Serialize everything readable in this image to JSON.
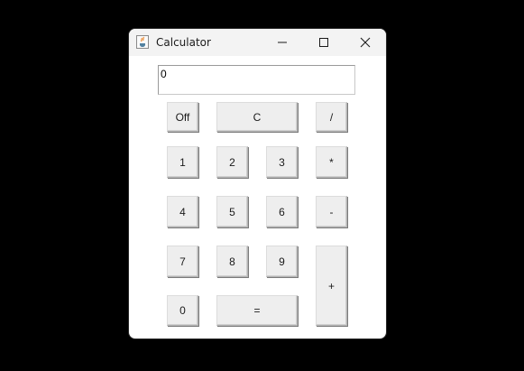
{
  "window": {
    "title": "Calculator",
    "app_icon": "java-cup-icon",
    "controls": {
      "minimize": "minimize-icon",
      "maximize": "maximize-icon",
      "close": "close-icon"
    }
  },
  "display": {
    "value": "0"
  },
  "keys": {
    "off": "Off",
    "clear": "C",
    "divide": "/",
    "one": "1",
    "two": "2",
    "three": "3",
    "multiply": "*",
    "four": "4",
    "five": "5",
    "six": "6",
    "subtract": "-",
    "seven": "7",
    "eight": "8",
    "nine": "9",
    "add": "+",
    "zero": "0",
    "equals": "="
  },
  "colors": {
    "background": "#000000",
    "window": "#ffffff",
    "titlebar": "#f3f3f3",
    "button_face": "#eeeeee"
  }
}
